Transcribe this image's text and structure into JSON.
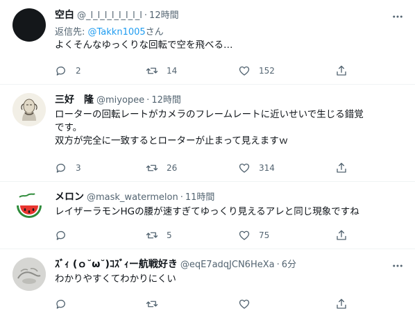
{
  "tweets": [
    {
      "name": "空白",
      "handle": "@_l_l_l_l_l_l_l_l",
      "time": "12時間",
      "reply_prefix": "返信先: ",
      "reply_mention": "@Takkn1005",
      "reply_suffix": "さん",
      "text": "よくそんなゆっくりな回転で空を飛べる…",
      "replies": "2",
      "retweets": "14",
      "likes": "152",
      "avatar": "black-circle"
    },
    {
      "name": "三好　隆",
      "handle": "@miyopee",
      "time": "12時間",
      "text": "ローターの回転レートがカメラのフレームレートに近いせいで生じる錯覚\nです。\n双方が完全に一致するとローターが止まって見えますｗ",
      "replies": "3",
      "retweets": "26",
      "likes": "314",
      "avatar": "sketch-portrait"
    },
    {
      "name": "メロン",
      "handle": "@mask_watermelon",
      "time": "11時間",
      "text": "レイザーラモンHGの腰が速すぎてゆっくり見えるアレと同じ現象ですね",
      "replies": "",
      "retweets": "5",
      "likes": "75",
      "avatar": "watermelon"
    },
    {
      "name": "ｽﾞｨ (ｏ˘ω˘)ｺｽﾞｨー航戦好き",
      "handle": "@eqE7adqJCN6HeXa",
      "time": "6分",
      "text": "わかりやすくてわかりにくい",
      "replies": "",
      "retweets": "",
      "likes": "",
      "avatar": "gray-sketch"
    }
  ],
  "separator": "·",
  "colors": {
    "text": "#0f1419",
    "secondary": "#536471",
    "link": "#1d9bf0",
    "border": "#eff3f4"
  }
}
